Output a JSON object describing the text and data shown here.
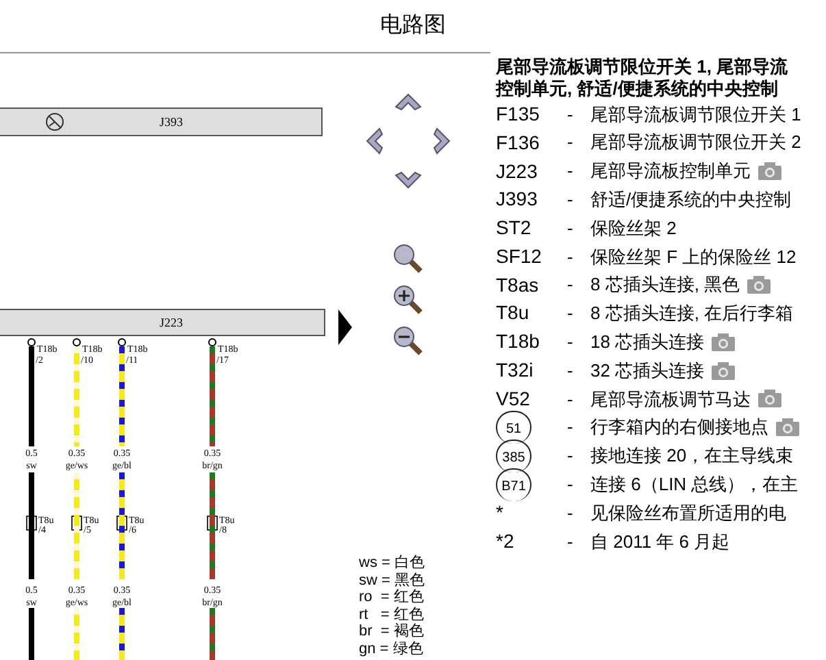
{
  "title": "电路图",
  "diagram": {
    "components": [
      {
        "label": "J393",
        "ground_symbol": true
      },
      {
        "label": "J223",
        "ground_symbol": false
      }
    ],
    "wires": [
      {
        "top_connector": "T18b",
        "top_pin": "/2",
        "size": "0.5",
        "color_code": "sw",
        "mid_connector": "T8u",
        "mid_pin": "/4",
        "lower_size": "0.5",
        "lower_color_code": "sw",
        "color": "#000000"
      },
      {
        "top_connector": "T18b",
        "top_pin": "/10",
        "size": "0.35",
        "color_code": "ge/ws",
        "mid_connector": "T8u",
        "mid_pin": "/5",
        "lower_size": "0.35",
        "lower_color_code": "ge/ws",
        "color": "#f5e81c",
        "stripe": {
          "color": "#fdf8d8"
        }
      },
      {
        "top_connector": "T18b",
        "top_pin": "/11",
        "size": "0.35",
        "color_code": "ge/bl",
        "mid_connector": "T8u",
        "mid_pin": "/6",
        "lower_size": "0.35",
        "lower_color_code": "ge/bl",
        "color": "#f5e81c",
        "stripe": {
          "color": "#1a1ad0"
        }
      },
      {
        "top_connector": "T18b",
        "top_pin": "/17",
        "size": "0.35",
        "color_code": "br/gn",
        "mid_connector": "T8u",
        "mid_pin": "/8",
        "lower_size": "0.35",
        "lower_color_code": "br/gn",
        "color": "#a33a2e",
        "stripe": {
          "color": "#1f7a1f"
        }
      }
    ]
  },
  "color_legend": [
    "ws = 白色",
    "sw = 黑色",
    "ro  = 红色",
    "rt   = 红色",
    "br  = 褐色",
    "gn = 绿色"
  ],
  "legend": {
    "heading": [
      "尾部导流板调节限位开关 1, 尾部导流",
      "控制单元, 舒适/便捷系统的中央控制"
    ],
    "entries": [
      {
        "kind": "text",
        "code": "F135",
        "dash": "-",
        "text": "尾部导流板调节限位开关 1",
        "photo": false
      },
      {
        "kind": "text",
        "code": "F136",
        "dash": "-",
        "text": "尾部导流板调节限位开关 2",
        "photo": false
      },
      {
        "kind": "text",
        "code": "J223",
        "dash": "-",
        "text": "尾部导流板控制单元",
        "photo": true
      },
      {
        "kind": "text",
        "code": "J393",
        "dash": "-",
        "text": "舒适/便捷系统的中央控制",
        "photo": false
      },
      {
        "kind": "text",
        "code": "ST2",
        "dash": "-",
        "text": "保险丝架 2",
        "photo": false
      },
      {
        "kind": "text",
        "code": "SF12",
        "dash": "-",
        "text": "保险丝架 F 上的保险丝 12",
        "photo": false
      },
      {
        "kind": "text",
        "code": "T8as",
        "dash": "-",
        "text": "8 芯插头连接, 黑色",
        "photo": true
      },
      {
        "kind": "text",
        "code": "T8u",
        "dash": "-",
        "text": "8 芯插头连接, 在后行李箱",
        "photo": false
      },
      {
        "kind": "text",
        "code": "T18b",
        "dash": "-",
        "text": "18 芯插头连接",
        "photo": true
      },
      {
        "kind": "text",
        "code": "T32i",
        "dash": "-",
        "text": "32 芯插头连接",
        "photo": true
      },
      {
        "kind": "text",
        "code": "V52",
        "dash": "-",
        "text": "尾部导流板调节马达",
        "photo": true
      },
      {
        "kind": "circled",
        "code": "51",
        "dash": "-",
        "text": "行李箱内的右侧接地点",
        "photo": true
      },
      {
        "kind": "circled",
        "code": "385",
        "dash": "-",
        "text": "接地连接 20，在主导线束",
        "photo": false
      },
      {
        "kind": "circled",
        "code": "B71",
        "dash": "-",
        "text": "连接 6（LIN 总线），在主",
        "photo": false
      },
      {
        "kind": "text",
        "code": "*",
        "dash": "-",
        "text": "见保险丝布置所适用的电",
        "photo": false
      },
      {
        "kind": "text",
        "code": "*2",
        "dash": "-",
        "text": "自 2011 年 6 月起",
        "photo": false
      }
    ]
  }
}
